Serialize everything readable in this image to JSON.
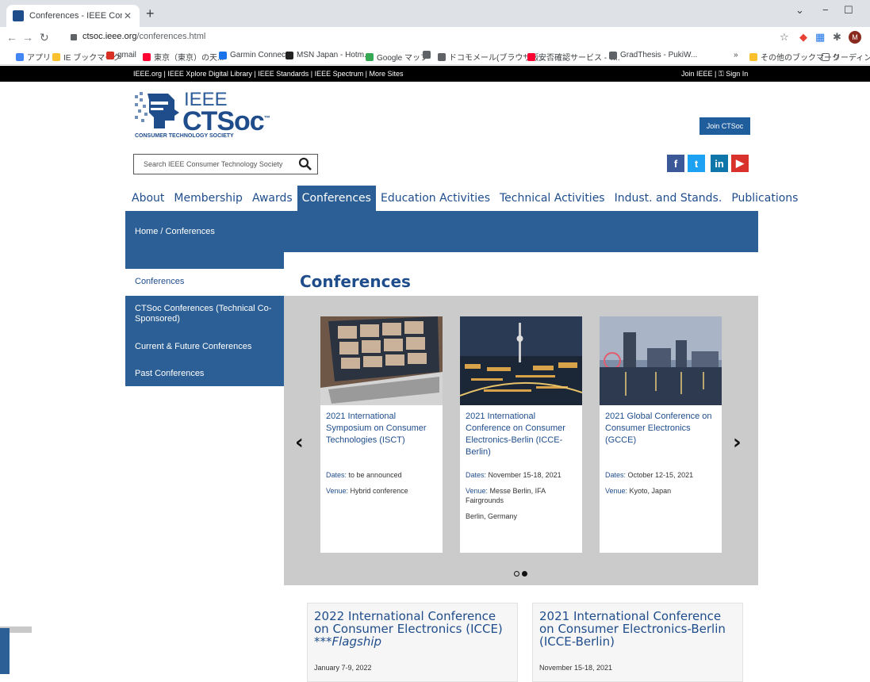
{
  "browser": {
    "tab_title": "Conferences - IEEE Consumer Te",
    "url_host": "ctsoc.ieee.org",
    "url_path": "/conferences.html",
    "avatar_initial": "M",
    "bookmarks": [
      {
        "label": "アプリ",
        "color": "#4285f4"
      },
      {
        "label": "IE ブックマーク",
        "color": "#fbc02d"
      },
      {
        "label": "gmail",
        "color": "#d93025"
      },
      {
        "label": "東京（東京）の天...",
        "color": "#ff0033"
      },
      {
        "label": "Garmin Connect",
        "color": "#1a73e8"
      },
      {
        "label": "MSN Japan - Hotm...",
        "color": "#222222"
      },
      {
        "label": "Google マップ",
        "color": "#34a853"
      },
      {
        "label": "",
        "color": "#5f6368"
      },
      {
        "label": "ドコモメール(ブラウザ版...",
        "color": "#5f6368"
      },
      {
        "label": "安否確認サービス - Y...",
        "color": "#ff0033"
      },
      {
        "label": "GradThesis - PukiW...",
        "color": "#5f6368"
      }
    ],
    "bookmarks_more": "»",
    "other_bookmarks": "その他のブックマーク",
    "reading_list": "リーディング リス"
  },
  "ieee_bar": {
    "left": "IEEE.org  |  IEEE Xplore Digital Library  |  IEEE Standards  |  IEEE Spectrum  |  More Sites",
    "right": "Join IEEE  |  ⚿ Sign In"
  },
  "header": {
    "logo_ieee": "IEEE",
    "logo_ctsoc": "CTSoc",
    "logo_tm": "™",
    "logo_sub": "CONSUMER TECHNOLOGY SOCIETY",
    "join_label": "Join CTSoc",
    "search_placeholder": "Search IEEE Consumer Technology Society",
    "social": [
      {
        "name": "facebook",
        "glyph": "f",
        "color": "#3b5998"
      },
      {
        "name": "twitter",
        "glyph": "t",
        "color": "#1da1f2"
      },
      {
        "name": "linkedin",
        "glyph": "in",
        "color": "#0e76a8"
      },
      {
        "name": "youtube",
        "glyph": "▶",
        "color": "#d9312b"
      }
    ]
  },
  "nav": {
    "items": [
      "About",
      "Membership",
      "Awards",
      "Conferences",
      "Education Activities",
      "Technical Activities",
      "Indust. and Stands.",
      "Publications"
    ],
    "active": "Conferences"
  },
  "breadcrumb": {
    "home": "Home",
    "sep": "/",
    "current": "Conferences"
  },
  "sidebar": {
    "active": "Conferences",
    "items": [
      "CTSoc Conferences (Technical Co-Sponsored)",
      "Current & Future Conferences",
      "Past Conferences"
    ]
  },
  "main": {
    "title": "Conferences",
    "carousel": {
      "prev_glyph": "‹",
      "next_glyph": "›",
      "cards": [
        {
          "title": "2021 International Symposium on Consumer Technologies (ISCT)",
          "dates_label": "Dates:",
          "dates": "to be announced",
          "venue_label": "Venue:",
          "venue": "Hybrid conference",
          "extra": ""
        },
        {
          "title": "2021 International Conference on Consumer Electronics-Berlin (ICCE-Berlin)",
          "dates_label": "Dates:",
          "dates": "November 15-18, 2021",
          "venue_label": "Venue:",
          "venue": "Messe Berlin, IFA Fairgrounds",
          "extra": "Berlin, Germany"
        },
        {
          "title": "2021 Global Conference on Consumer Electronics (GCCE)",
          "dates_label": "Dates:",
          "dates": "October 12-15, 2021",
          "venue_label": "Venue:",
          "venue": "Kyoto, Japan",
          "extra": ""
        }
      ],
      "active_dot": 1
    },
    "featured": [
      {
        "title": "2022 International Conference on Consumer Electronics (ICCE)",
        "flag": "***Flagship",
        "date": "January 7-9, 2022"
      },
      {
        "title": "2021 International Conference on Consumer Electronics-Berlin (ICCE-Berlin)",
        "flag": "",
        "date": "November 15-18, 2021"
      }
    ]
  }
}
